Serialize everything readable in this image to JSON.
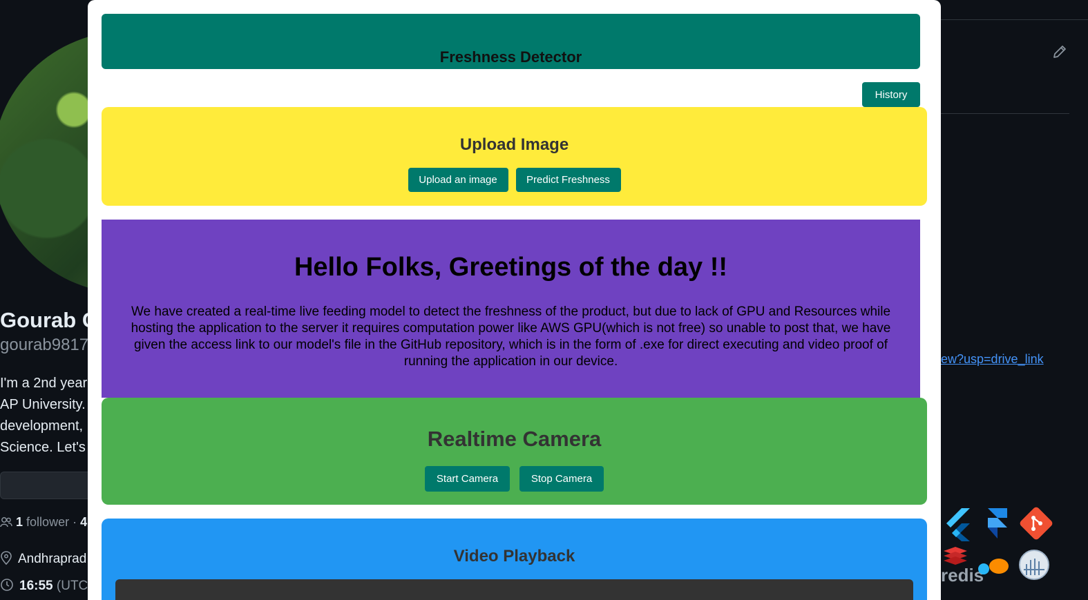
{
  "background": {
    "profile_name": "Gourab C",
    "profile_handle": "gourab9817",
    "bio_lines": [
      "I'm a 2nd year",
      "AP University.",
      "development,",
      "Science. Let's"
    ],
    "followers_count": "1",
    "followers_label": "follower ·",
    "following_count": "4",
    "location": "Andhraprad",
    "local_time": "16:55",
    "utc_label": "(UTC",
    "drive_link_text": "ew?usp=drive_link",
    "redis_text": "redis",
    "colors": {
      "page_bg": "#0d1117",
      "link": "#4493f8"
    }
  },
  "modal": {
    "header_title": "Freshness Detector",
    "history_label": "History",
    "upload": {
      "title": "Upload Image",
      "upload_button": "Upload an image",
      "predict_button": "Predict Freshness"
    },
    "info": {
      "heading": "Hello Folks, Greetings of the day !!",
      "body": "We have created a real-time live feeding model to detect the freshness of the product, but due to lack of GPU and Resources while hosting the application to the server it requires computation power like AWS GPU(which is not free) so unable to post that, we have given the access link to our model's file in the GitHub repository, which is in the form of .exe for direct executing and video proof of running the application in our device."
    },
    "camera": {
      "title": "Realtime Camera",
      "start_button": "Start Camera",
      "stop_button": "Stop Camera"
    },
    "video": {
      "title": "Video Playback"
    },
    "colors": {
      "primary": "#00796b",
      "upload_bg": "#ffeb3b",
      "info_bg": "#6f42c1",
      "camera_bg": "#4caf50",
      "video_bg": "#2196f3"
    }
  }
}
